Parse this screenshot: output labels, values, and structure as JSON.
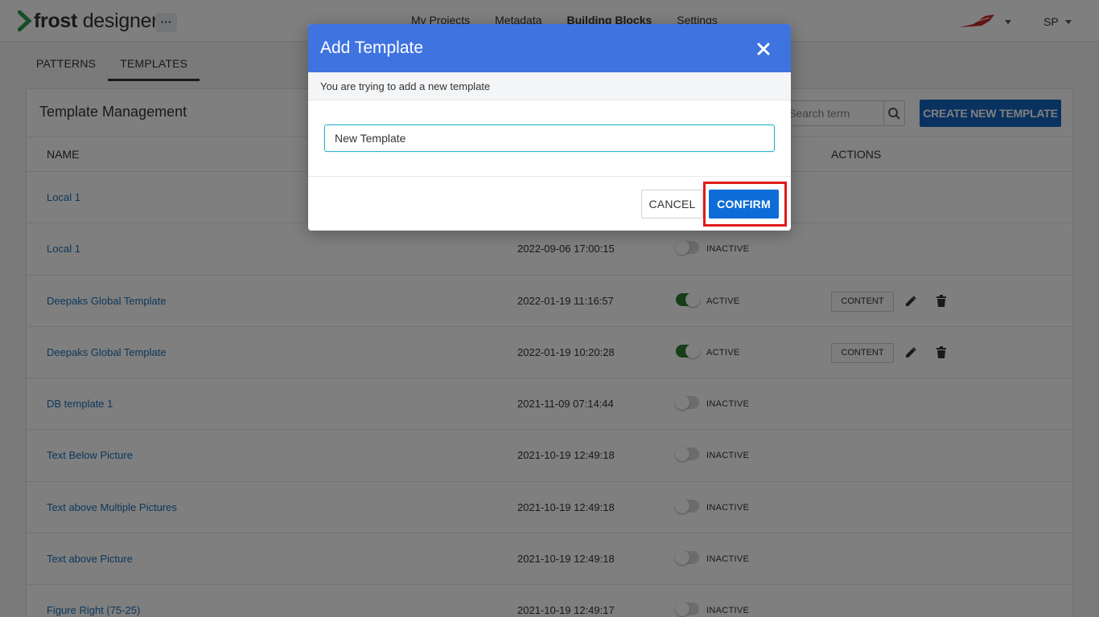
{
  "header": {
    "logo_bold": "frost",
    "logo_rest": " designer",
    "more_label": "···",
    "nav": [
      {
        "label": "My Projects",
        "active": false
      },
      {
        "label": "Metadata",
        "active": false
      },
      {
        "label": "Building Blocks",
        "active": true
      },
      {
        "label": "Settings",
        "active": false
      }
    ],
    "user_initials": "SP"
  },
  "tabs": [
    {
      "label": "PATTERNS",
      "active": false
    },
    {
      "label": "TEMPLATES",
      "active": true
    }
  ],
  "panel": {
    "title": "Template Management",
    "search_placeholder": "Search term",
    "create_label": "CREATE NEW TEMPLATE",
    "col_name": "NAME",
    "col_actions": "ACTIONS"
  },
  "rows": [
    {
      "name": "Local 1",
      "date": "",
      "status": "",
      "active": null,
      "has_actions": false
    },
    {
      "name": "Local 1",
      "date": "2022-09-06 17:00:15",
      "status": "INACTIVE",
      "active": false,
      "has_actions": false
    },
    {
      "name": "Deepaks Global Template",
      "date": "2022-01-19 11:16:57",
      "status": "ACTIVE",
      "active": true,
      "has_actions": true
    },
    {
      "name": "Deepaks Global Template",
      "date": "2022-01-19 10:20:28",
      "status": "ACTIVE",
      "active": true,
      "has_actions": true
    },
    {
      "name": "DB template 1",
      "date": "2021-11-09 07:14:44",
      "status": "INACTIVE",
      "active": false,
      "has_actions": false
    },
    {
      "name": "Text Below Picture",
      "date": "2021-10-19 12:49:18",
      "status": "INACTIVE",
      "active": false,
      "has_actions": false
    },
    {
      "name": "Text above Multiple Pictures",
      "date": "2021-10-19 12:49:18",
      "status": "INACTIVE",
      "active": false,
      "has_actions": false
    },
    {
      "name": "Text above Picture",
      "date": "2021-10-19 12:49:18",
      "status": "INACTIVE",
      "active": false,
      "has_actions": false
    },
    {
      "name": "Figure Right (75-25)",
      "date": "2021-10-19 12:49:17",
      "status": "INACTIVE",
      "active": false,
      "has_actions": false
    }
  ],
  "content_label": "CONTENT",
  "modal": {
    "title": "Add Template",
    "subtitle": "You are trying to add a new template",
    "input_value": "New Template",
    "cancel_label": "CANCEL",
    "confirm_label": "CONFIRM"
  },
  "colors": {
    "modal_header": "#3f74e0",
    "confirm": "#0d6cd8",
    "highlight": "#e01b1b",
    "link": "#1a6fb7",
    "toggle_on": "#2e7d32"
  }
}
